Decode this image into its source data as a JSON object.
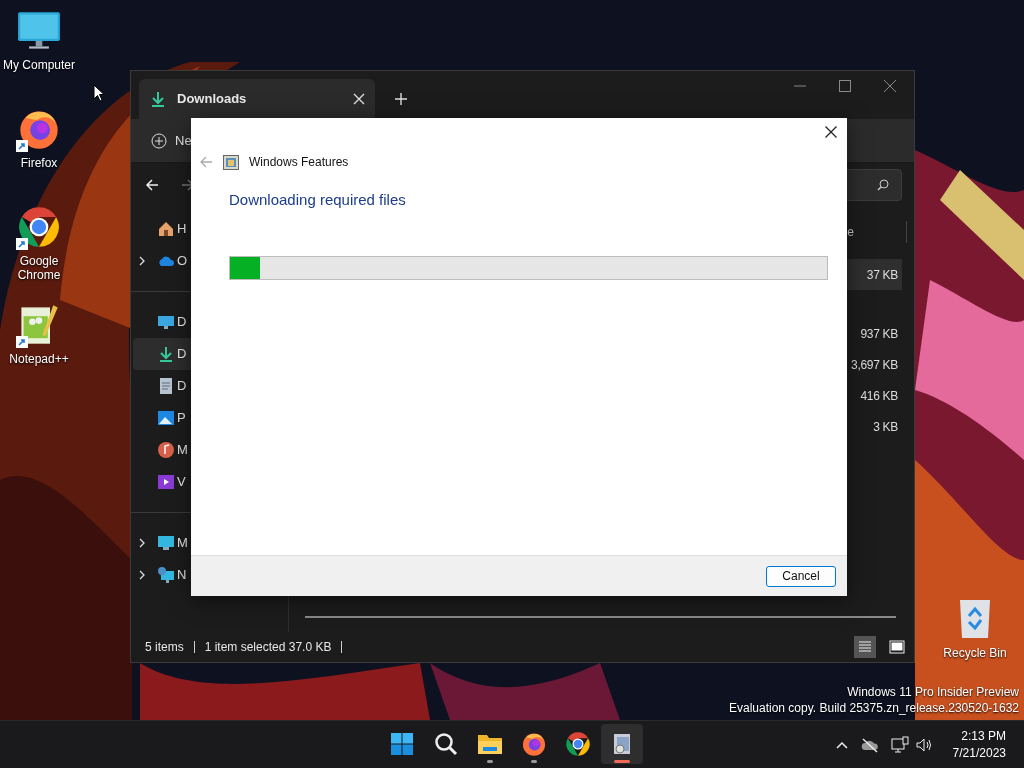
{
  "desktop_icons": [
    {
      "label": "My Computer",
      "kind": "monitor",
      "shortcut": false
    },
    {
      "label": "Firefox",
      "kind": "firefox",
      "shortcut": true
    },
    {
      "label": "Google Chrome",
      "kind": "chrome",
      "shortcut": true
    },
    {
      "label": "Notepad++",
      "kind": "notepad",
      "shortcut": true
    }
  ],
  "recycle_bin": {
    "label": "Recycle Bin"
  },
  "system_notice": [
    "Windows 11 Pro Insider Preview",
    "Evaluation copy. Build 25375.zn_release.230520-1632"
  ],
  "explorer": {
    "tab": {
      "title": "Downloads"
    },
    "new_button": "Ne",
    "sidebar_groups": [
      [
        {
          "label": "H",
          "kind": "home",
          "expandable": false,
          "selected": false
        },
        {
          "label": "O",
          "kind": "cloud",
          "expandable": true,
          "selected": false
        }
      ],
      [
        {
          "label": "D",
          "kind": "desktop",
          "expandable": false,
          "selected": false
        },
        {
          "label": "D",
          "kind": "download",
          "expandable": false,
          "selected": true
        },
        {
          "label": "D",
          "kind": "document",
          "expandable": false,
          "selected": false
        },
        {
          "label": "P",
          "kind": "pictures",
          "expandable": false,
          "selected": false
        },
        {
          "label": "M",
          "kind": "music",
          "expandable": false,
          "selected": false
        },
        {
          "label": "V",
          "kind": "videos",
          "expandable": false,
          "selected": false
        }
      ],
      [
        {
          "label": "M",
          "kind": "pc",
          "expandable": true,
          "selected": false
        },
        {
          "label": "N",
          "kind": "network",
          "expandable": true,
          "selected": false
        }
      ]
    ],
    "column_header": "e",
    "size_groups": [
      [
        {
          "size": "37 KB",
          "selected": true
        }
      ],
      [
        {
          "size": "937 KB",
          "selected": false
        },
        {
          "size": "3,697 KB",
          "selected": false
        },
        {
          "size": "416 KB",
          "selected": false
        },
        {
          "size": "3 KB",
          "selected": false
        }
      ]
    ],
    "status": {
      "items": "5 items",
      "selection": "1 item selected 37.0 KB"
    },
    "view_buttons": [
      {
        "kind": "details",
        "selected": true
      },
      {
        "kind": "tiles",
        "selected": false
      }
    ]
  },
  "dialog": {
    "title": "Windows Features",
    "heading": "Downloading required files",
    "progress": {
      "level": 0.05
    },
    "buttons": [
      "Cancel"
    ]
  },
  "taskbar": {
    "apps": [
      {
        "kind": "start",
        "running": false,
        "active": false
      },
      {
        "kind": "search",
        "running": false,
        "active": false
      },
      {
        "kind": "folder",
        "running": true,
        "active": false
      },
      {
        "kind": "firefox",
        "running": true,
        "active": false
      },
      {
        "kind": "chrome",
        "running": false,
        "active": false
      },
      {
        "kind": "features",
        "running": true,
        "active": true
      }
    ],
    "clock": {
      "time": "2:13 PM",
      "date": "7/21/2023"
    }
  }
}
